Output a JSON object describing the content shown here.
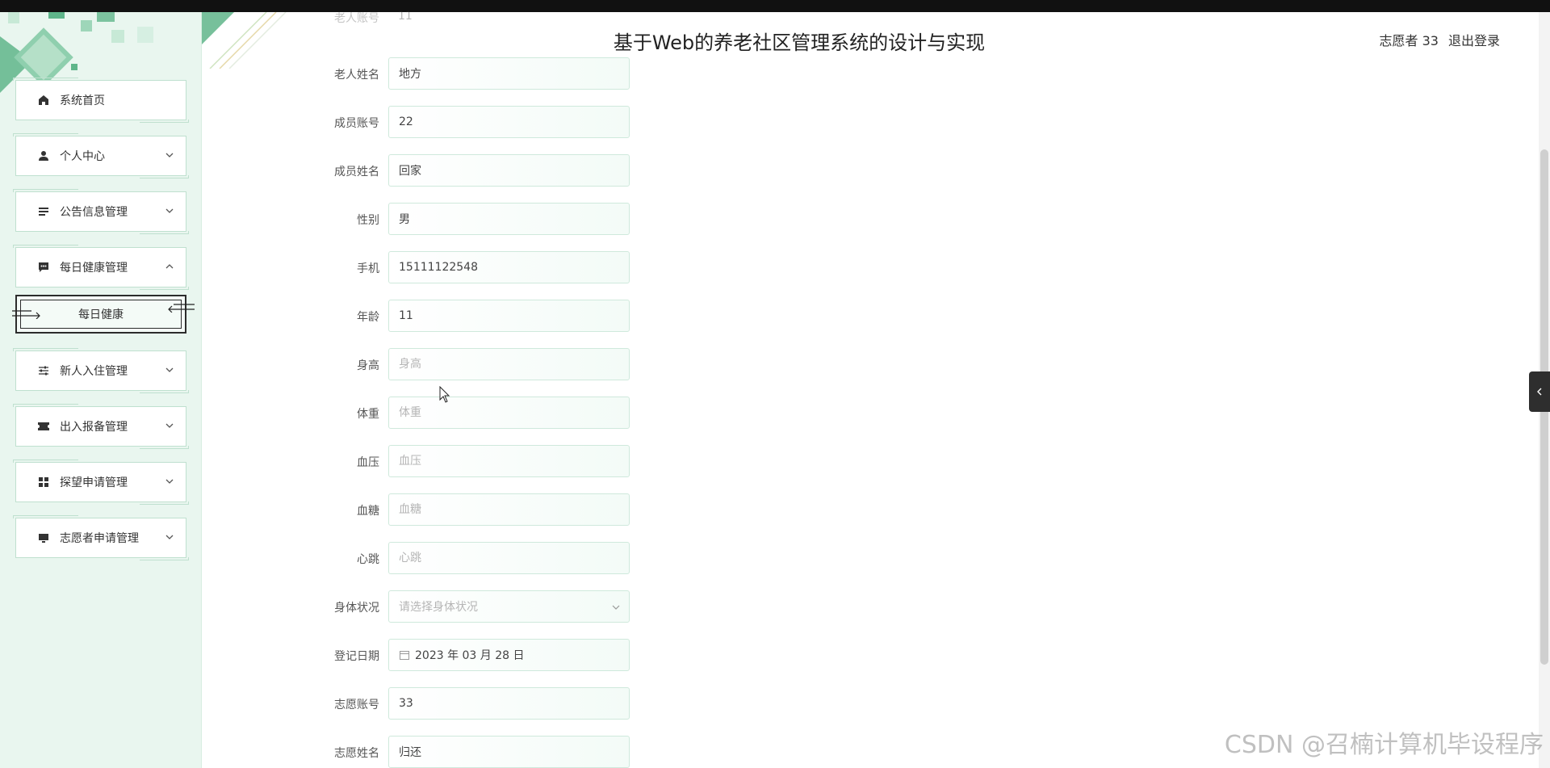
{
  "app": {
    "title": "基于Web的养老社区管理系统的设计与实现",
    "user_label": "志愿者 33",
    "logout_label": "退出登录"
  },
  "sidebar": {
    "items": [
      {
        "label": "系统首页",
        "icon": "home-icon",
        "expandable": false
      },
      {
        "label": "个人中心",
        "icon": "person-icon",
        "expandable": true
      },
      {
        "label": "公告信息管理",
        "icon": "list-icon",
        "expandable": true
      },
      {
        "label": "每日健康管理",
        "icon": "chat-icon",
        "expandable": true,
        "expanded": true
      },
      {
        "label": "新人入住管理",
        "icon": "sliders-icon",
        "expandable": true
      },
      {
        "label": "出入报备管理",
        "icon": "ticket-icon",
        "expandable": true
      },
      {
        "label": "探望申请管理",
        "icon": "grid-icon",
        "expandable": true
      },
      {
        "label": "志愿者申请管理",
        "icon": "monitor-icon",
        "expandable": true
      }
    ],
    "submenu_label": "每日健康"
  },
  "form": {
    "top_partial_label": "老人账号",
    "top_partial_value": "11",
    "fields": [
      {
        "label": "老人姓名",
        "value": "地方",
        "placeholder": ""
      },
      {
        "label": "成员账号",
        "value": "22",
        "placeholder": ""
      },
      {
        "label": "成员姓名",
        "value": "回家",
        "placeholder": ""
      },
      {
        "label": "性别",
        "value": "男",
        "placeholder": ""
      },
      {
        "label": "手机",
        "value": "15111122548",
        "placeholder": ""
      },
      {
        "label": "年龄",
        "value": "11",
        "placeholder": ""
      },
      {
        "label": "身高",
        "value": "",
        "placeholder": "身高"
      },
      {
        "label": "体重",
        "value": "",
        "placeholder": "体重"
      },
      {
        "label": "血压",
        "value": "",
        "placeholder": "血压"
      },
      {
        "label": "血糖",
        "value": "",
        "placeholder": "血糖"
      },
      {
        "label": "心跳",
        "value": "",
        "placeholder": "心跳"
      }
    ],
    "status_label": "身体状况",
    "status_placeholder": "请选择身体状况",
    "date_label": "登记日期",
    "date_value": "2023 年 03 月 28 日",
    "vol_account_label": "志愿账号",
    "vol_account_value": "33",
    "vol_name_label": "志愿姓名",
    "vol_name_value": "归还"
  },
  "watermark": "CSDN @召楠计算机毕设程序",
  "colors": {
    "accent": "#5fb58a",
    "sidebar_bg": "#e9f6ef",
    "border": "#cfe9dc"
  }
}
